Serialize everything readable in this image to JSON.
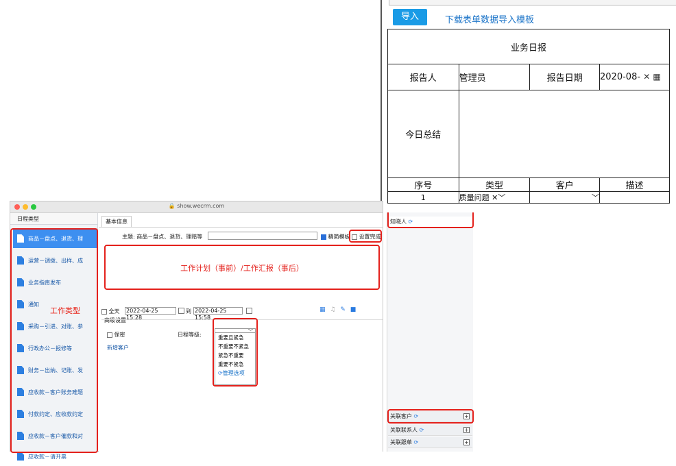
{
  "form": {
    "import_label": "导入",
    "template_link": "下载表单数据导入模板",
    "title": "业务日报",
    "reporter_label": "报告人",
    "reporter_value": "管理员",
    "date_label": "报告日期",
    "date_value": "2020-08-",
    "summary_label": "今日总结",
    "columns": [
      "序号",
      "类型",
      "客户",
      "描述"
    ],
    "row": {
      "index": "1",
      "type": "质量问题"
    }
  },
  "browser": {
    "url": "show.wecrm.com"
  },
  "sidebar": {
    "header": "日程类型",
    "annotation": "工作类型",
    "items": [
      "商品－盘点、退货、理",
      "运营－调拨、出样、成",
      "业务指南发布",
      "通知",
      "采购－引进、对账、参",
      "行政办公－报修等",
      "财务－出纳、记账、发",
      "应收款－客户账务难题",
      "付款约定、应收款约定",
      "应收款－客户催款和对",
      "应收款－请开票"
    ]
  },
  "main": {
    "tab": "基本信息",
    "subject_label": "主题: 商品－盘点、退货、理赔等",
    "simple_template": "精简模板",
    "done_label": "设置完成",
    "plan_annotation": "工作计划（事前）/工作汇报（事后）",
    "allday": "全天",
    "start": "2022-04-25 15:28",
    "to": "到",
    "end": "2022-04-25 15:58",
    "advanced": "高级设置",
    "secret": "保密",
    "level_label": "日程等级:",
    "new_customer": "新增客户",
    "levels": [
      "重要且紧急",
      "不重要不紧急",
      "紧急不重要",
      "重要不紧急"
    ],
    "manage": "管理选项"
  },
  "right_panel": {
    "known": "知晓人",
    "related": [
      "关联客户",
      "关联联系人",
      "关联跟单"
    ]
  }
}
